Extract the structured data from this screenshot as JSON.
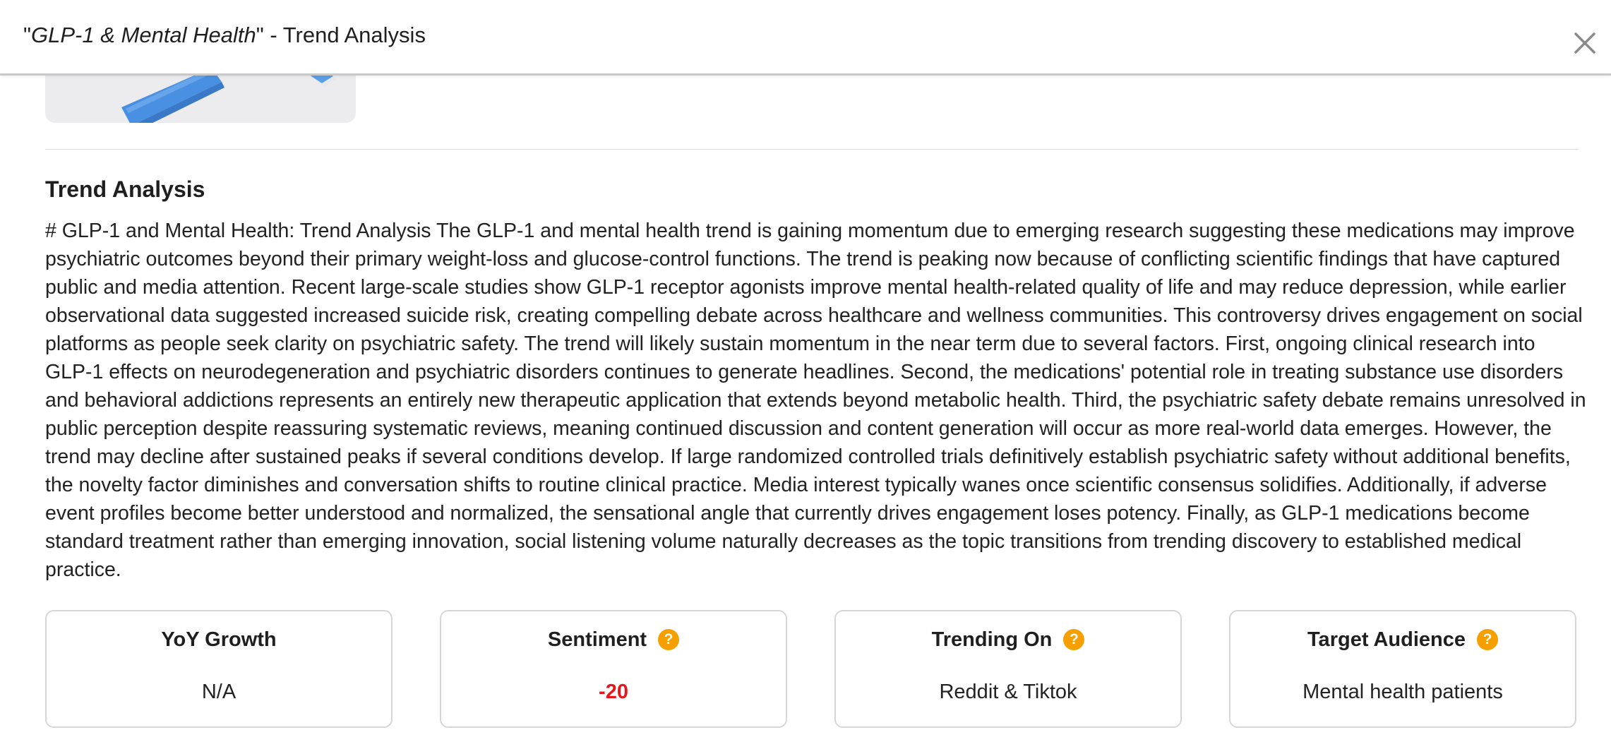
{
  "header": {
    "title_prefix": "\"",
    "title_topic": "GLP-1 & Mental Health",
    "title_suffix": "\" - Trend Analysis",
    "close_icon": "close-icon"
  },
  "image_card": {
    "icon": "product-image"
  },
  "section": {
    "title": "Trend Analysis",
    "body": "# GLP-1 and Mental Health: Trend Analysis The GLP-1 and mental health trend is gaining momentum due to emerging research suggesting these medications may improve psychiatric outcomes beyond their primary weight-loss and glucose-control functions. The trend is peaking now because of conflicting scientific findings that have captured public and media attention. Recent large-scale studies show GLP-1 receptor agonists improve mental health-related quality of life and may reduce depression, while earlier observational data suggested increased suicide risk, creating compelling debate across healthcare and wellness communities. This controversy drives engagement on social platforms as people seek clarity on psychiatric safety. The trend will likely sustain momentum in the near term due to several factors. First, ongoing clinical research into GLP-1 effects on neurodegeneration and psychiatric disorders continues to generate headlines. Second, the medications' potential role in treating substance use disorders and behavioral addictions represents an entirely new therapeutic application that extends beyond metabolic health. Third, the psychiatric safety debate remains unresolved in public perception despite reassuring systematic reviews, meaning continued discussion and content generation will occur as more real-world data emerges. However, the trend may decline after sustained peaks if several conditions develop. If large randomized controlled trials definitively establish psychiatric safety without additional benefits, the novelty factor diminishes and conversation shifts to routine clinical practice. Media interest typically wanes once scientific consensus solidifies. Additionally, if adverse event profiles become better understood and normalized, the sensational angle that currently drives engagement loses potency. Finally, as GLP-1 medications become standard treatment rather than emerging innovation, social listening volume naturally decreases as the topic transitions from trending discovery to established medical practice."
  },
  "metrics": [
    {
      "label": "YoY Growth",
      "value": "N/A",
      "has_help": false
    },
    {
      "label": "Sentiment",
      "value": "-20",
      "has_help": true,
      "help_glyph": "?",
      "value_color": "#e8141b"
    },
    {
      "label": "Trending On",
      "value": "Reddit & Tiktok",
      "has_help": true,
      "help_glyph": "?"
    },
    {
      "label": "Target Audience",
      "value": "Mental health patients",
      "has_help": true,
      "help_glyph": "?"
    }
  ],
  "colors": {
    "help_icon": "#f5a000",
    "negative_value": "#e8141b",
    "card_border": "#d6d6d6"
  }
}
